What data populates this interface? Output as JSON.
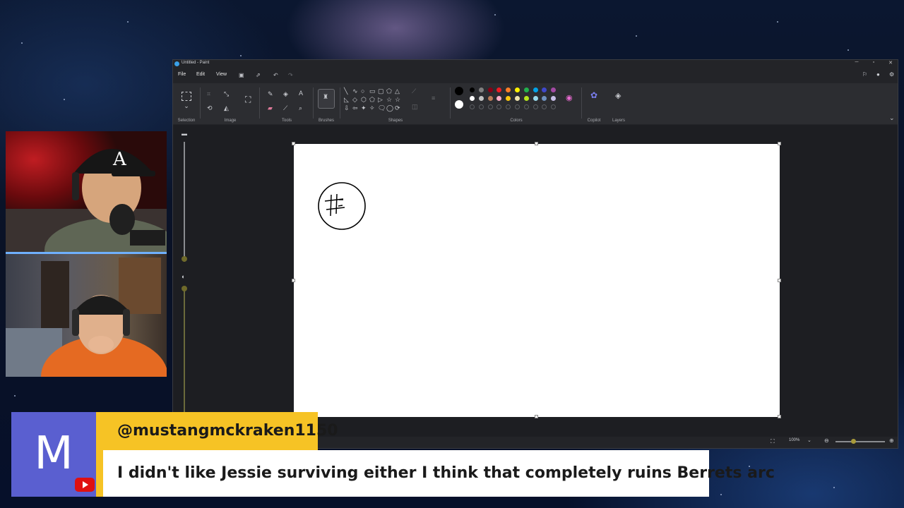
{
  "window": {
    "title": "Untitled - Paint",
    "controls": [
      "─",
      "▫",
      "✕"
    ]
  },
  "menubar": {
    "items": [
      "File",
      "Edit",
      "View"
    ],
    "quick_actions": [
      "save-icon",
      "share-icon",
      "undo-icon",
      "redo-icon"
    ]
  },
  "ribbon": {
    "groups": {
      "selection": "Selection",
      "image": "Image",
      "tools": "Tools",
      "brushes": "Brushes",
      "shapes": "Shapes",
      "colors": "Colors",
      "copilot": "Copilot",
      "layers": "Layers"
    },
    "shape_glyphs": [
      "╲",
      "∿",
      "○",
      "▭",
      "▢",
      "⬠",
      "△",
      "◺",
      "◇",
      "⬡",
      "⬠",
      "▷",
      "☆",
      "☆",
      "⇩",
      "⇦",
      "✦",
      "✧",
      "🗨",
      "◯",
      "⟳"
    ],
    "palette_row1": [
      "#000000",
      "#7f7f7f",
      "#880015",
      "#ed1c24",
      "#ff7f27",
      "#fff200",
      "#22b14c",
      "#00a2e8",
      "#3f48cc",
      "#a349a4"
    ],
    "palette_row2": [
      "#ffffff",
      "#c3c3c3",
      "#b97a57",
      "#ffaec9",
      "#ffc90e",
      "#efe4b0",
      "#b5e61d",
      "#99d9ea",
      "#7092be",
      "#c8bfe7"
    ],
    "current_primary": "#000000",
    "current_secondary": "#ffffff"
  },
  "status": {
    "zoom": "100%",
    "zoom_level": 0.36
  },
  "chat": {
    "avatar_letter": "M",
    "username": "@mustangmckraken1150",
    "message": "I didn't like Jessie surviving either I think that completely ruins Berrets arc",
    "platform": "youtube-icon"
  }
}
